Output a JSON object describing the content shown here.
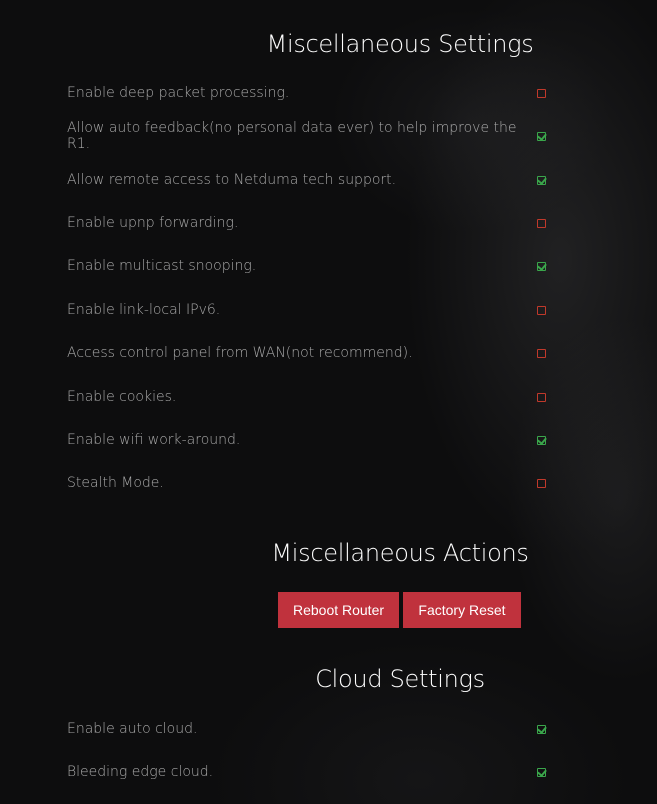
{
  "misc_settings": {
    "title": "Miscellaneous Settings",
    "items": [
      {
        "label": "Enable deep packet processing.",
        "checked": false
      },
      {
        "label": "Allow auto feedback(no personal data ever) to help improve the R1.",
        "checked": true
      },
      {
        "label": "Allow remote access to Netduma tech support.",
        "checked": true
      },
      {
        "label": "Enable upnp forwarding.",
        "checked": false
      },
      {
        "label": "Enable multicast snooping.",
        "checked": true
      },
      {
        "label": "Enable link-local IPv6.",
        "checked": false
      },
      {
        "label": "Access control panel from WAN(not recommend).",
        "checked": false
      },
      {
        "label": "Enable cookies.",
        "checked": false
      },
      {
        "label": "Enable wifi work-around.",
        "checked": true
      },
      {
        "label": "Stealth Mode.",
        "checked": false
      }
    ]
  },
  "misc_actions": {
    "title": "Miscellaneous Actions",
    "reboot_label": "Reboot Router",
    "reset_label": "Factory Reset"
  },
  "cloud_settings": {
    "title": "Cloud Settings",
    "items": [
      {
        "label": "Enable auto cloud.",
        "checked": true
      },
      {
        "label": "Bleeding edge cloud.",
        "checked": true
      }
    ]
  },
  "colors": {
    "checked": "#3aa64b",
    "unchecked": "#c0392b",
    "button": "#c0323d"
  }
}
